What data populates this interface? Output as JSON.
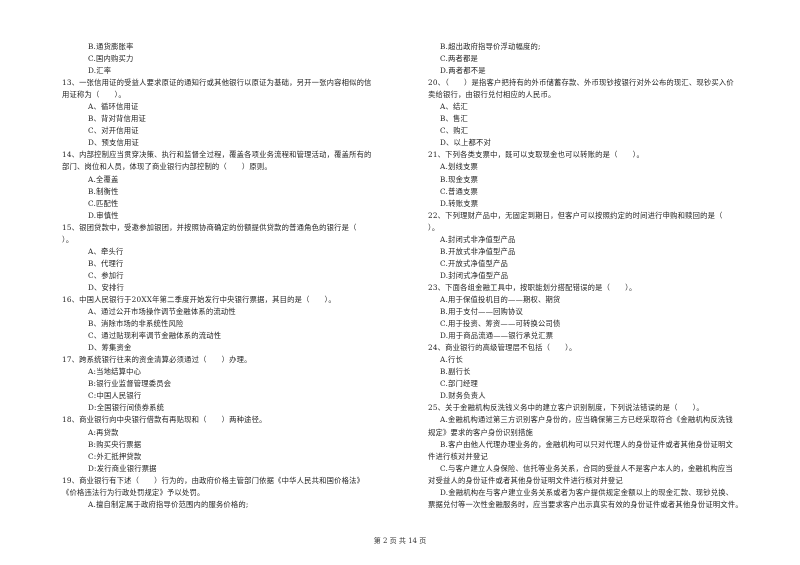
{
  "left_column": {
    "lines": [
      {
        "text": "B.通货膨胀率",
        "kind": "opt"
      },
      {
        "text": "C.国内购买力",
        "kind": "opt"
      },
      {
        "text": "D.汇率",
        "kind": "opt"
      },
      {
        "text": "13、一张信用证的受益人要求原证的通知行或其他银行以原证为基础，另开一张内容相似的信",
        "kind": "q"
      },
      {
        "text": "用证称为（　　）。",
        "kind": "q"
      },
      {
        "text": "A、循环信用证",
        "kind": "opt"
      },
      {
        "text": "B、背对背信用证",
        "kind": "opt"
      },
      {
        "text": "C、对开信用证",
        "kind": "opt"
      },
      {
        "text": "D、预支信用证",
        "kind": "opt"
      },
      {
        "text": "14、内部控制应当贯穿决策、执行和监督全过程，覆盖各项业务流程和管理活动，覆盖所有的",
        "kind": "q"
      },
      {
        "text": "部门、岗位和人员，体现了商业银行内部控制的（　　）原则。",
        "kind": "q"
      },
      {
        "text": "A.全覆盖",
        "kind": "opt"
      },
      {
        "text": "B.制衡性",
        "kind": "opt"
      },
      {
        "text": "C.匹配性",
        "kind": "opt"
      },
      {
        "text": "D.审慎性",
        "kind": "opt"
      },
      {
        "text": "15、银团贷款中，受邀参加银团，并按照协商确定的份额提供贷款的普通角色的银行是（",
        "kind": "q"
      },
      {
        "text": "）。",
        "kind": "q"
      },
      {
        "text": "A、牵头行",
        "kind": "opt"
      },
      {
        "text": "B、代理行",
        "kind": "opt"
      },
      {
        "text": "C、参加行",
        "kind": "opt"
      },
      {
        "text": "D、安排行",
        "kind": "opt"
      },
      {
        "text": "16、中国人民银行于20XX年第二季度开始发行中央银行票据，其目的是（　　）。",
        "kind": "q"
      },
      {
        "text": "A、通过公开市场操作调节金融体系的流动性",
        "kind": "opt"
      },
      {
        "text": "B、消除市场的非系统性风险",
        "kind": "opt"
      },
      {
        "text": "C、通过贴现利率调节金融体系的流动性",
        "kind": "opt"
      },
      {
        "text": "D、筹集资金",
        "kind": "opt"
      },
      {
        "text": "17、跨系统银行往来的资金清算必须通过（　　）办理。",
        "kind": "q"
      },
      {
        "text": "A:当地结算中心",
        "kind": "opt"
      },
      {
        "text": "B:银行业监督管理委员会",
        "kind": "opt"
      },
      {
        "text": "C:中国人民银行",
        "kind": "opt"
      },
      {
        "text": "D:全国银行间债券系统",
        "kind": "opt"
      },
      {
        "text": "18、商业银行向中央银行借款有再贴现和（　　）两种途径。",
        "kind": "q"
      },
      {
        "text": "A:再贷款",
        "kind": "opt"
      },
      {
        "text": "B:购买央行票据",
        "kind": "opt"
      },
      {
        "text": "C:外汇抵押贷款",
        "kind": "opt"
      },
      {
        "text": "D:发行商业银行票据",
        "kind": "opt"
      },
      {
        "text": "19、商业银行有下述（　　）行为的，由政府价格主管部门依据《中华人民共和国价格法》",
        "kind": "q"
      },
      {
        "text": "《价格违法行为行政处罚规定》予以处罚。",
        "kind": "q"
      },
      {
        "text": "A.擅自制定属于政府指导价范围内的服务价格的;",
        "kind": "opt"
      }
    ]
  },
  "right_column": {
    "lines": [
      {
        "text": "B.超出政府指导价浮动幅度的;",
        "kind": "opt"
      },
      {
        "text": "C.两者都是",
        "kind": "opt"
      },
      {
        "text": "D.两者都不是",
        "kind": "opt"
      },
      {
        "text": "20、（　　）是指客户把持有的外币储蓄存款、外币现钞按银行对外公布的现汇、现钞买入价",
        "kind": "q"
      },
      {
        "text": "卖给银行，由银行兑付相应的人民币。",
        "kind": "q"
      },
      {
        "text": "A、结汇",
        "kind": "opt"
      },
      {
        "text": "B、售汇",
        "kind": "opt"
      },
      {
        "text": "C、购汇",
        "kind": "opt"
      },
      {
        "text": "D、以上都不对",
        "kind": "opt"
      },
      {
        "text": "21、下列各类支票中，既可以支取现金也可以转账的是（　　）。",
        "kind": "q"
      },
      {
        "text": "A.划线支票",
        "kind": "opt"
      },
      {
        "text": "B.现金支票",
        "kind": "opt"
      },
      {
        "text": "C.普通支票",
        "kind": "opt"
      },
      {
        "text": "D.转账支票",
        "kind": "opt"
      },
      {
        "text": "22、下列理财产品中，无固定到期日，但客户可以按照约定的时间进行申购和赎回的是（",
        "kind": "q"
      },
      {
        "text": "）。",
        "kind": "q"
      },
      {
        "text": "A.封闭式非净值型产品",
        "kind": "opt"
      },
      {
        "text": "B.开放式非净值型产品",
        "kind": "opt"
      },
      {
        "text": "C.开放式净值型产品",
        "kind": "opt"
      },
      {
        "text": "D.封闭式净值型产品",
        "kind": "opt"
      },
      {
        "text": "23、下面各组金融工具中，按职能划分搭配错误的是（　　）。",
        "kind": "q"
      },
      {
        "text": "A.用于保值投机目的——期权、期货",
        "kind": "opt"
      },
      {
        "text": "B.用于支付——回购协议",
        "kind": "opt"
      },
      {
        "text": "C.用于投资、筹资——可转换公司债",
        "kind": "opt"
      },
      {
        "text": "D.用于商品流通——银行承兑汇票",
        "kind": "opt"
      },
      {
        "text": "24、商业银行的高级管理层不包括（　　）。",
        "kind": "q"
      },
      {
        "text": "A.行长",
        "kind": "opt"
      },
      {
        "text": "B.副行长",
        "kind": "opt"
      },
      {
        "text": "C.部门经理",
        "kind": "opt"
      },
      {
        "text": "D.财务负责人",
        "kind": "opt"
      },
      {
        "text": "25、关于金融机构反洗钱义务中的建立客户识别制度，下列说法错误的是（　　）。",
        "kind": "q"
      },
      {
        "text": "A.金融机构通过第三方识别客户身份的，应当确保第三方已经采取符合《金融机构反洗钱",
        "kind": "opt"
      },
      {
        "text": "规定》要求的客户身份识别措施",
        "kind": "q"
      },
      {
        "text": "B.客户由他人代理办理业务的，金融机构可以只对代理人的身份证件或者其他身份证明文",
        "kind": "opt"
      },
      {
        "text": "件进行核对并登记",
        "kind": "q"
      },
      {
        "text": "C.与客户建立人身保险、信托等业务关系，合同的受益人不是客户本人的，金融机构应当",
        "kind": "opt"
      },
      {
        "text": "对受益人的身份证件或者其他身份证明文件进行核对并登记",
        "kind": "q"
      },
      {
        "text": "D.金融机构在与客户建立业务关系或者为客户提供规定金额以上的现金汇款、现钞兑换、",
        "kind": "opt"
      },
      {
        "text": "票据兑付等一次性金融服务时，应当要求客户出示真实有效的身份证件或者其他身份证明文件。",
        "kind": "q"
      }
    ]
  },
  "footer": {
    "page_label": "第 2 页 共 14 页"
  }
}
